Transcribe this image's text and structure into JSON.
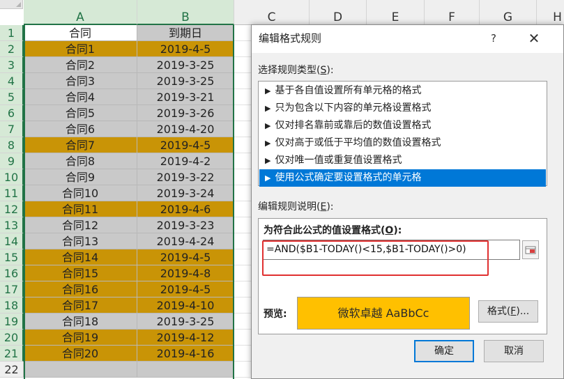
{
  "sheet": {
    "columns": [
      "A",
      "B",
      "C",
      "D",
      "E",
      "F",
      "G",
      "H"
    ],
    "header_row": {
      "row": "1",
      "a": "合同",
      "b": "到期日"
    },
    "rows": [
      {
        "row": "2",
        "a": "合同1",
        "b": "2019-4-5",
        "fill": "#C99406"
      },
      {
        "row": "3",
        "a": "合同2",
        "b": "2019-3-25",
        "fill": "#C9C9C9"
      },
      {
        "row": "4",
        "a": "合同3",
        "b": "2019-3-25",
        "fill": "#C9C9C9"
      },
      {
        "row": "5",
        "a": "合同4",
        "b": "2019-3-21",
        "fill": "#C9C9C9"
      },
      {
        "row": "6",
        "a": "合同5",
        "b": "2019-3-26",
        "fill": "#C9C9C9"
      },
      {
        "row": "7",
        "a": "合同6",
        "b": "2019-4-20",
        "fill": "#C9C9C9"
      },
      {
        "row": "8",
        "a": "合同7",
        "b": "2019-4-5",
        "fill": "#C99406"
      },
      {
        "row": "9",
        "a": "合同8",
        "b": "2019-4-2",
        "fill": "#C9C9C9"
      },
      {
        "row": "10",
        "a": "合同9",
        "b": "2019-3-22",
        "fill": "#C9C9C9"
      },
      {
        "row": "11",
        "a": "合同10",
        "b": "2019-3-24",
        "fill": "#C9C9C9"
      },
      {
        "row": "12",
        "a": "合同11",
        "b": "2019-4-6",
        "fill": "#C99406"
      },
      {
        "row": "13",
        "a": "合同12",
        "b": "2019-3-23",
        "fill": "#C9C9C9"
      },
      {
        "row": "14",
        "a": "合同13",
        "b": "2019-4-24",
        "fill": "#C9C9C9"
      },
      {
        "row": "15",
        "a": "合同14",
        "b": "2019-4-5",
        "fill": "#C99406"
      },
      {
        "row": "16",
        "a": "合同15",
        "b": "2019-4-8",
        "fill": "#C99406"
      },
      {
        "row": "17",
        "a": "合同16",
        "b": "2019-4-5",
        "fill": "#C99406"
      },
      {
        "row": "18",
        "a": "合同17",
        "b": "2019-4-10",
        "fill": "#C99406"
      },
      {
        "row": "19",
        "a": "合同18",
        "b": "2019-3-25",
        "fill": "#C9C9C9"
      },
      {
        "row": "20",
        "a": "合同19",
        "b": "2019-4-12",
        "fill": "#C99406"
      },
      {
        "row": "21",
        "a": "合同20",
        "b": "2019-4-16",
        "fill": "#C99406"
      },
      {
        "row": "22",
        "a": "",
        "b": "",
        "fill": "#C9C9C9"
      }
    ],
    "highlight_color": "#C99406",
    "gray_color": "#C9C9C9",
    "selection_color": "#217346"
  },
  "dialog": {
    "title": "编辑格式规则",
    "help_label": "?",
    "close_label": "✕",
    "select_type_label_pre": "选择规则类型(",
    "select_type_key": "S",
    "select_type_label_post": "):",
    "rule_types": [
      "基于各自值设置所有单元格的格式",
      "只为包含以下内容的单元格设置格式",
      "仅对排名靠前或靠后的数值设置格式",
      "仅对高于或低于平均值的数值设置格式",
      "仅对唯一值或重复值设置格式",
      "使用公式确定要设置格式的单元格"
    ],
    "selected_rule_index": 5,
    "rule_arrow": "▶",
    "edit_desc_label_pre": "编辑规则说明(",
    "edit_desc_key": "E",
    "edit_desc_label_post": "):",
    "formula_label_pre": "为符合此公式的值设置格式(",
    "formula_label_key": "O",
    "formula_label_post": "):",
    "formula_value": "=AND($B1-TODAY()<15,$B1-TODAY()>0)",
    "preview_label": "预览:",
    "preview_text": "微软卓越  AaBbCc",
    "preview_color": "#FFC000",
    "format_button_pre": "格式(",
    "format_button_key": "F",
    "format_button_post": ")...",
    "ok_label": "确定",
    "cancel_label": "取消",
    "accent_color": "#0078D7",
    "annotation_color": "#E03030"
  }
}
